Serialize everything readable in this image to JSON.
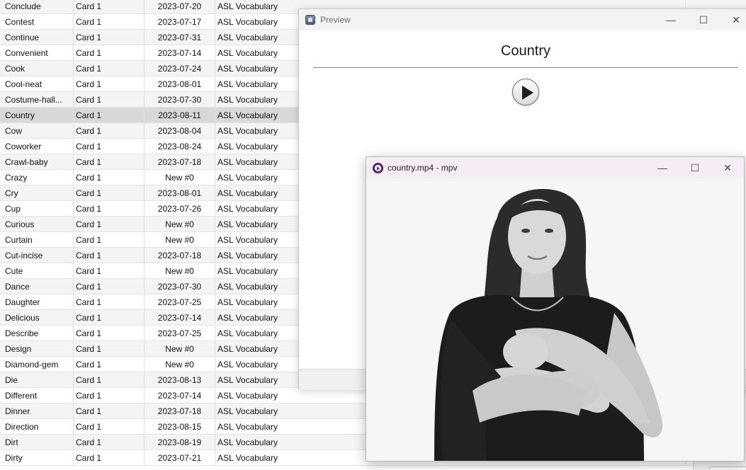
{
  "browser": {
    "selected_index": 7,
    "rows": [
      {
        "sort_field": "Conclude",
        "card": "Card 1",
        "due": "2023-07-20",
        "deck": "ASL Vocabulary"
      },
      {
        "sort_field": "Contest",
        "card": "Card 1",
        "due": "2023-07-17",
        "deck": "ASL Vocabulary"
      },
      {
        "sort_field": "Continue",
        "card": "Card 1",
        "due": "2023-07-31",
        "deck": "ASL Vocabulary"
      },
      {
        "sort_field": "Convenient",
        "card": "Card 1",
        "due": "2023-07-14",
        "deck": "ASL Vocabulary"
      },
      {
        "sort_field": "Cook",
        "card": "Card 1",
        "due": "2023-07-24",
        "deck": "ASL Vocabulary"
      },
      {
        "sort_field": "Cool-neat",
        "card": "Card 1",
        "due": "2023-08-01",
        "deck": "ASL Vocabulary"
      },
      {
        "sort_field": "Costume-hall...",
        "card": "Card 1",
        "due": "2023-07-30",
        "deck": "ASL Vocabulary"
      },
      {
        "sort_field": "Country",
        "card": "Card 1",
        "due": "2023-08-11",
        "deck": "ASL Vocabulary"
      },
      {
        "sort_field": "Cow",
        "card": "Card 1",
        "due": "2023-08-04",
        "deck": "ASL Vocabulary"
      },
      {
        "sort_field": "Coworker",
        "card": "Card 1",
        "due": "2023-08-24",
        "deck": "ASL Vocabulary"
      },
      {
        "sort_field": "Crawl-baby",
        "card": "Card 1",
        "due": "2023-07-18",
        "deck": "ASL Vocabulary"
      },
      {
        "sort_field": "Crazy",
        "card": "Card 1",
        "due": "New #0",
        "deck": "ASL Vocabulary"
      },
      {
        "sort_field": "Cry",
        "card": "Card 1",
        "due": "2023-08-01",
        "deck": "ASL Vocabulary"
      },
      {
        "sort_field": "Cup",
        "card": "Card 1",
        "due": "2023-07-26",
        "deck": "ASL Vocabulary"
      },
      {
        "sort_field": "Curious",
        "card": "Card 1",
        "due": "New #0",
        "deck": "ASL Vocabulary"
      },
      {
        "sort_field": "Curtain",
        "card": "Card 1",
        "due": "New #0",
        "deck": "ASL Vocabulary"
      },
      {
        "sort_field": "Cut-incise",
        "card": "Card 1",
        "due": "2023-07-18",
        "deck": "ASL Vocabulary"
      },
      {
        "sort_field": "Cute",
        "card": "Card 1",
        "due": "New #0",
        "deck": "ASL Vocabulary"
      },
      {
        "sort_field": "Dance",
        "card": "Card 1",
        "due": "2023-07-30",
        "deck": "ASL Vocabulary"
      },
      {
        "sort_field": "Daughter",
        "card": "Card 1",
        "due": "2023-07-25",
        "deck": "ASL Vocabulary"
      },
      {
        "sort_field": "Delicious",
        "card": "Card 1",
        "due": "2023-07-14",
        "deck": "ASL Vocabulary"
      },
      {
        "sort_field": "Describe",
        "card": "Card 1",
        "due": "2023-07-25",
        "deck": "ASL Vocabulary"
      },
      {
        "sort_field": "Design",
        "card": "Card 1",
        "due": "New #0",
        "deck": "ASL Vocabulary"
      },
      {
        "sort_field": "Diamond-gem",
        "card": "Card 1",
        "due": "New #0",
        "deck": "ASL Vocabulary"
      },
      {
        "sort_field": "Die",
        "card": "Card 1",
        "due": "2023-08-13",
        "deck": "ASL Vocabulary"
      },
      {
        "sort_field": "Different",
        "card": "Card 1",
        "due": "2023-07-14",
        "deck": "ASL Vocabulary"
      },
      {
        "sort_field": "Dinner",
        "card": "Card 1",
        "due": "2023-07-18",
        "deck": "ASL Vocabulary"
      },
      {
        "sort_field": "Direction",
        "card": "Card 1",
        "due": "2023-08-15",
        "deck": "ASL Vocabulary"
      },
      {
        "sort_field": "Dirt",
        "card": "Card 1",
        "due": "2023-08-19",
        "deck": "ASL Vocabulary"
      },
      {
        "sort_field": "Dirty",
        "card": "Card 1",
        "due": "2023-07-21",
        "deck": "ASL Vocabulary"
      }
    ]
  },
  "preview": {
    "title": "Preview",
    "icon": "anki-preview-icon",
    "card_front": "Country",
    "play_icon": "play-icon",
    "controls": {
      "minimize": "—",
      "maximize": "☐",
      "close": "✕"
    }
  },
  "mpv": {
    "title": "country.mp4 - mpv",
    "icon": "mpv-icon",
    "controls": {
      "minimize": "—",
      "maximize": "☐",
      "close": "✕"
    }
  },
  "colors": {
    "selected_row": "#d8d8d8",
    "mpv_titlebar": "#f5ecf5",
    "mpv_brand": "#5a2d74"
  }
}
